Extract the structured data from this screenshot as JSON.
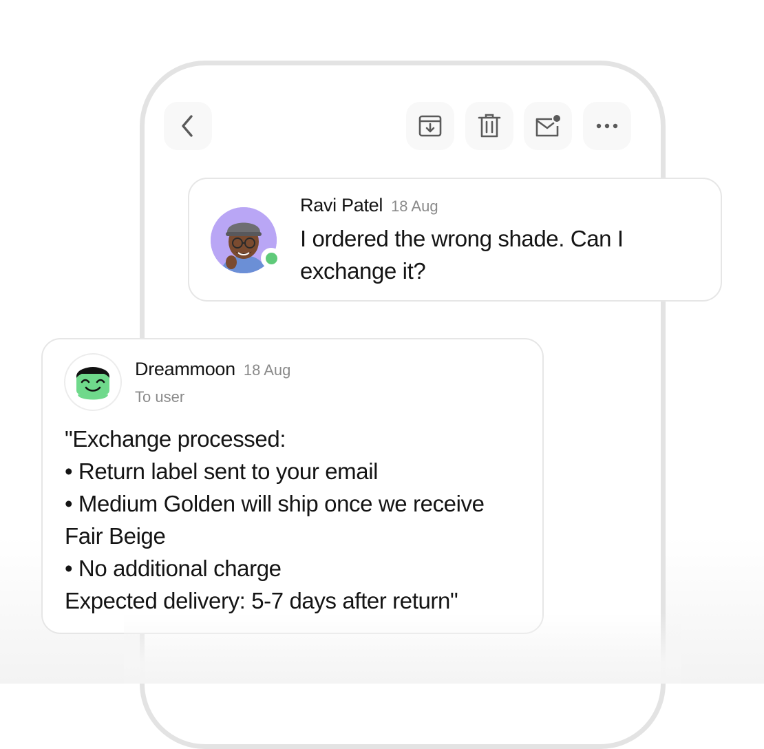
{
  "toolbar": {
    "back_icon": "chevron-left-icon",
    "archive_icon": "archive-icon",
    "delete_icon": "trash-icon",
    "mark_unread_icon": "mail-unread-icon",
    "more_icon": "more-horizontal-icon"
  },
  "incoming_message": {
    "sender": "Ravi Patel",
    "date": "18 Aug",
    "body_lines": [
      "I ordered the wrong shade. Can I",
      "exchange it?"
    ],
    "online_status_color": "#5fca7a"
  },
  "reply_message": {
    "sender": "Dreammoon",
    "date": "18 Aug",
    "recipient": "To user",
    "body_lines": [
      "\"Exchange processed:",
      "• Return label sent to your email",
      "• Medium Golden will ship once we receive",
      "Fair Beige",
      "• No additional charge",
      "Expected delivery: 5-7 days after return\""
    ]
  },
  "colors": {
    "phone_border": "#e3e3e3",
    "card_border": "#e6e6e6",
    "avatar_bg_ravi": "#b9a6f5",
    "avatar_face_dreammoon": "#6fd98b"
  }
}
